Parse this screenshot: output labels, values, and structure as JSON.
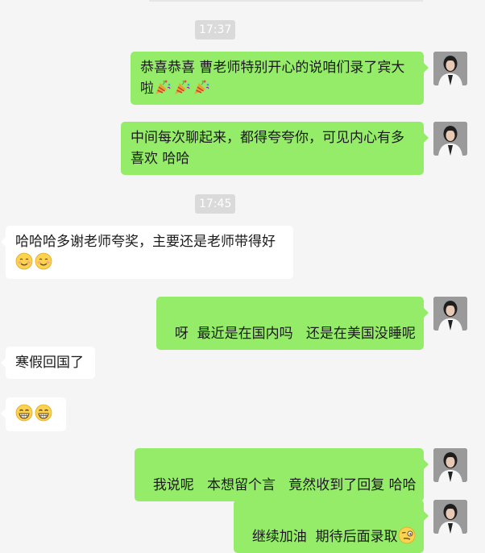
{
  "timestamps": [
    "17:37",
    "17:45"
  ],
  "messages": [
    {
      "side": "out",
      "text": "恭喜恭喜 曹老师特别开心的说咱们录了宾大啦",
      "emojis": [
        "party-popper",
        "party-popper",
        "party-popper"
      ]
    },
    {
      "side": "out",
      "text": "中间每次聊起来，都得夸夸你，可见内心有多喜欢 哈哈",
      "emojis": []
    },
    {
      "side": "in",
      "text": "哈哈哈多谢老师夸奖，主要还是老师带得好",
      "emojis": [
        "smile",
        "smile"
      ]
    },
    {
      "side": "out",
      "text": "呀  最近是在国内吗   还是在美国没睡呢",
      "emojis": []
    },
    {
      "side": "in",
      "text": "寒假回国了",
      "emojis": []
    },
    {
      "side": "in",
      "text": "",
      "emojis": [
        "grin",
        "grin"
      ]
    },
    {
      "side": "out",
      "text": "我说呢   本想留个言   竟然收到了回复 哈哈",
      "emojis": []
    },
    {
      "side": "out",
      "text": "继续加油  期待后面录取",
      "emojis": [
        "smirk"
      ]
    }
  ],
  "colors": {
    "outgoing_bubble": "#95ec69",
    "incoming_bubble": "#ffffff",
    "background": "#f5f5f5"
  }
}
